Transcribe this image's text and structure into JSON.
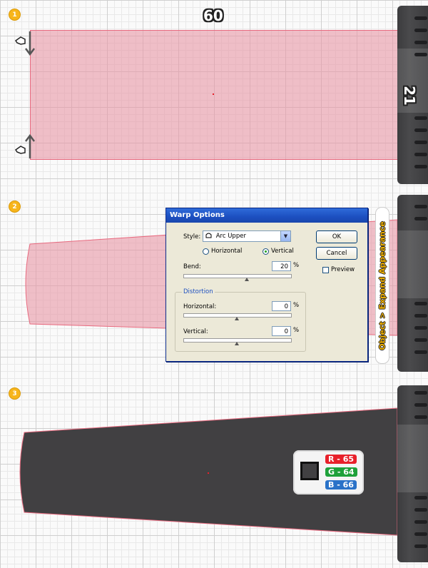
{
  "steps": {
    "one": "1",
    "two": "2",
    "three": "3"
  },
  "step1": {
    "width_value": "60",
    "height_value": "21"
  },
  "warp_dialog": {
    "title": "Warp Options",
    "style_label": "Style:",
    "style_value": "Arc Upper",
    "horizontal_label": "Horizontal",
    "vertical_label": "Vertical",
    "bend_label": "Bend:",
    "bend_value": "20",
    "percent": "%",
    "distortion_label": "Distortion",
    "dist_horizontal_label": "Horizontal:",
    "dist_horizontal_value": "0",
    "dist_vertical_label": "Vertical:",
    "dist_vertical_value": "0",
    "ok_label": "OK",
    "cancel_label": "Cancel",
    "preview_label": "Preview",
    "orientation_selected": "Vertical",
    "preview_checked": false
  },
  "menu_path": "Object > Expand Appearance",
  "color": {
    "r": "R - 65",
    "g": "G - 64",
    "b": "B - 66",
    "fill_hex": "#414042"
  },
  "colors": {
    "badge": "#f7b51b",
    "pink": "#e8a0ad",
    "strap": "#3c3c3e",
    "red": "#e8202a",
    "green": "#1ea13a",
    "blue": "#2a72c8"
  }
}
